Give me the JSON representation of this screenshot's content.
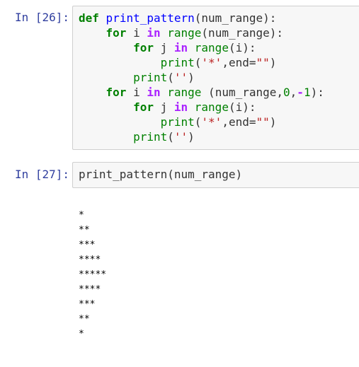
{
  "cells": [
    {
      "prompt": "In [26]:",
      "lines": [
        [
          "def",
          " ",
          "print_pattern",
          "(num_range):"
        ],
        [
          "    ",
          "for",
          " i ",
          "in",
          " ",
          "range",
          "(num_range):"
        ],
        [
          "        ",
          "for",
          " j ",
          "in",
          " ",
          "range",
          "(i):"
        ],
        [
          "            ",
          "print",
          "(",
          "'*'",
          ",end=",
          "\"\"",
          ")"
        ],
        [
          "        ",
          "print",
          "(",
          "''",
          ")"
        ],
        [
          "    ",
          "for",
          " i ",
          "in",
          " ",
          "range",
          " (num_range,",
          "0",
          ",",
          "-",
          "1",
          "):"
        ],
        [
          "        ",
          "for",
          " j ",
          "in",
          " ",
          "range",
          "(i):"
        ],
        [
          "            ",
          "print",
          "(",
          "'*'",
          ",end=",
          "\"\"",
          ")"
        ],
        [
          "        ",
          "print",
          "(",
          "''",
          ")"
        ]
      ]
    },
    {
      "prompt": "In [27]:",
      "code": "print_pattern(num_range)"
    }
  ],
  "output_lines": [
    "*",
    "**",
    "***",
    "****",
    "*****",
    "****",
    "***",
    "**",
    "*"
  ]
}
